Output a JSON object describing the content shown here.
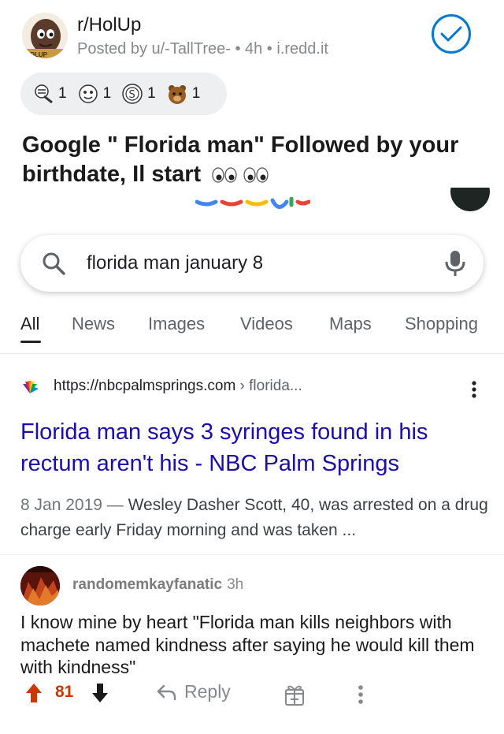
{
  "post": {
    "subreddit": "r/HolUp",
    "meta": "Posted by u/-TallTree- • 4h • i.redd.it",
    "title": "Google \" Florida man\" Followed by your birthdate, Il start",
    "avatar_label": "HOLUP",
    "awards": [
      {
        "icon": "award-1-icon",
        "count": "1"
      },
      {
        "icon": "award-2-icon",
        "count": "1"
      },
      {
        "icon": "award-3-icon",
        "count": "1"
      },
      {
        "icon": "award-4-icon",
        "count": "1"
      }
    ]
  },
  "google": {
    "query": "florida man january 8",
    "tabs": [
      "All",
      "News",
      "Images",
      "Videos",
      "Maps",
      "Shopping"
    ],
    "active_tab": "All",
    "result": {
      "url": "https://nbcpalmsprings.com",
      "crumb": " › florida...",
      "title": "Florida man says 3 syringes found in his rectum aren't his - NBC Palm Springs",
      "date": "8 Jan 2019 —",
      "snippet": " Wesley Dasher Scott, 40, was arrested on a drug charge early Friday morning and was taken ..."
    }
  },
  "comment": {
    "author": "randomemkayfanatic",
    "time": "3h",
    "body": "I know mine by heart \"Florida man kills neighbors with machete named kindness after saying he would kill them with kindness\"",
    "votes": "81",
    "reply_label": "Reply"
  },
  "colors": {
    "accent_blue": "#0079d3",
    "link_blue": "#1a0dab",
    "upvote_orange": "#cc3700"
  }
}
